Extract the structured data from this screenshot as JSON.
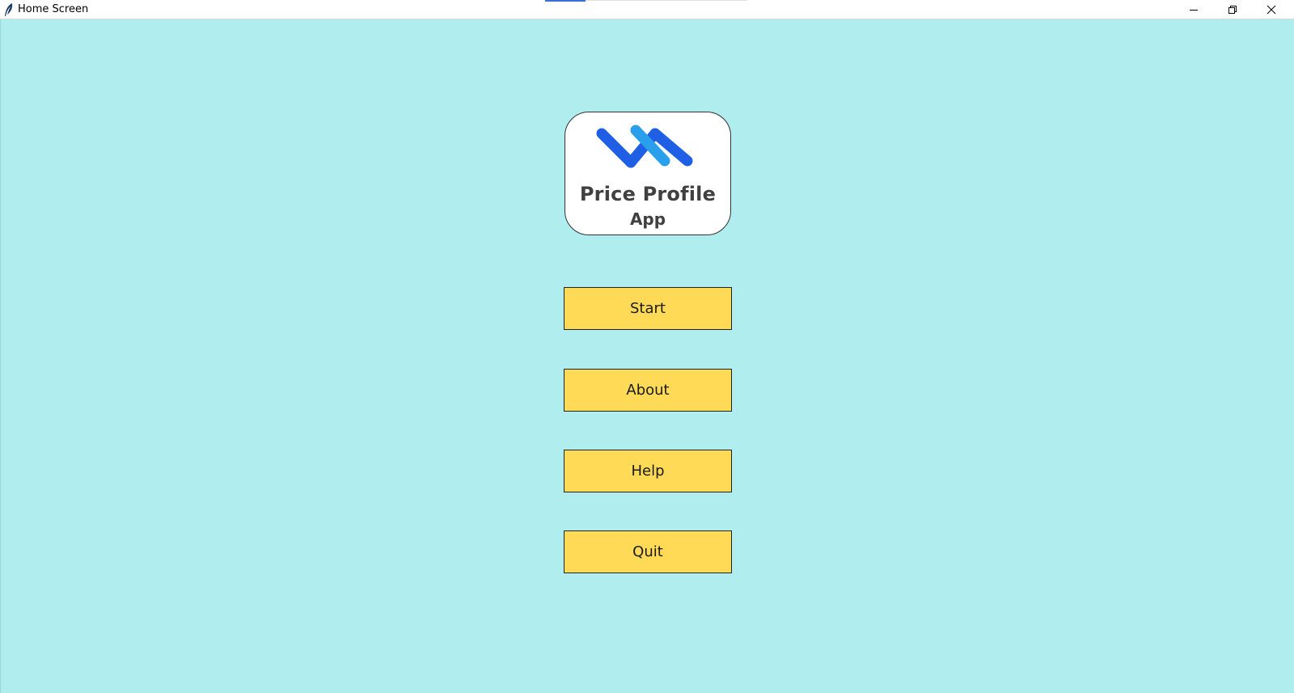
{
  "window": {
    "title": "Home Screen",
    "app_icon": "feather-icon",
    "controls": {
      "minimize": "minimize-icon",
      "maximize": "restore-icon",
      "close": "close-icon"
    }
  },
  "colors": {
    "background": "#afedee",
    "button_fill": "#ffda57",
    "logo_dark_blue": "#1f5fe6",
    "logo_light_blue": "#2aa0ec",
    "logo_text": "#404040"
  },
  "logo": {
    "name": "Price Profile",
    "sub": "App",
    "mark_icon": "zigzag-chart-icon"
  },
  "buttons": {
    "start": "Start",
    "about": "About",
    "help": "Help",
    "quit": "Quit"
  }
}
